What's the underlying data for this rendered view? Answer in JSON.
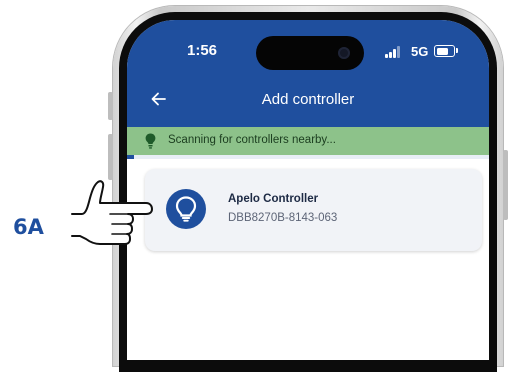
{
  "status_bar": {
    "time": "1:56",
    "network": "5G",
    "icons": [
      "signal-icon",
      "battery-icon"
    ]
  },
  "header": {
    "title": "Add controller",
    "back_icon": "arrow-left-icon"
  },
  "scan_banner": {
    "text": "Scanning for controllers nearby...",
    "icon": "lightbulb-icon"
  },
  "scan_progress": {
    "fraction": 0.02
  },
  "controllers": [
    {
      "name": "Apelo Controller",
      "serial": "DBB8270B-8143-063",
      "icon": "lightbulb-icon"
    }
  ],
  "callout": {
    "label": "6A",
    "icon": "pointing-hand-icon"
  },
  "colors": {
    "brand_blue": "#1f4f9e",
    "banner_green": "#8dc28a",
    "card_bg": "#f1f3f7"
  }
}
